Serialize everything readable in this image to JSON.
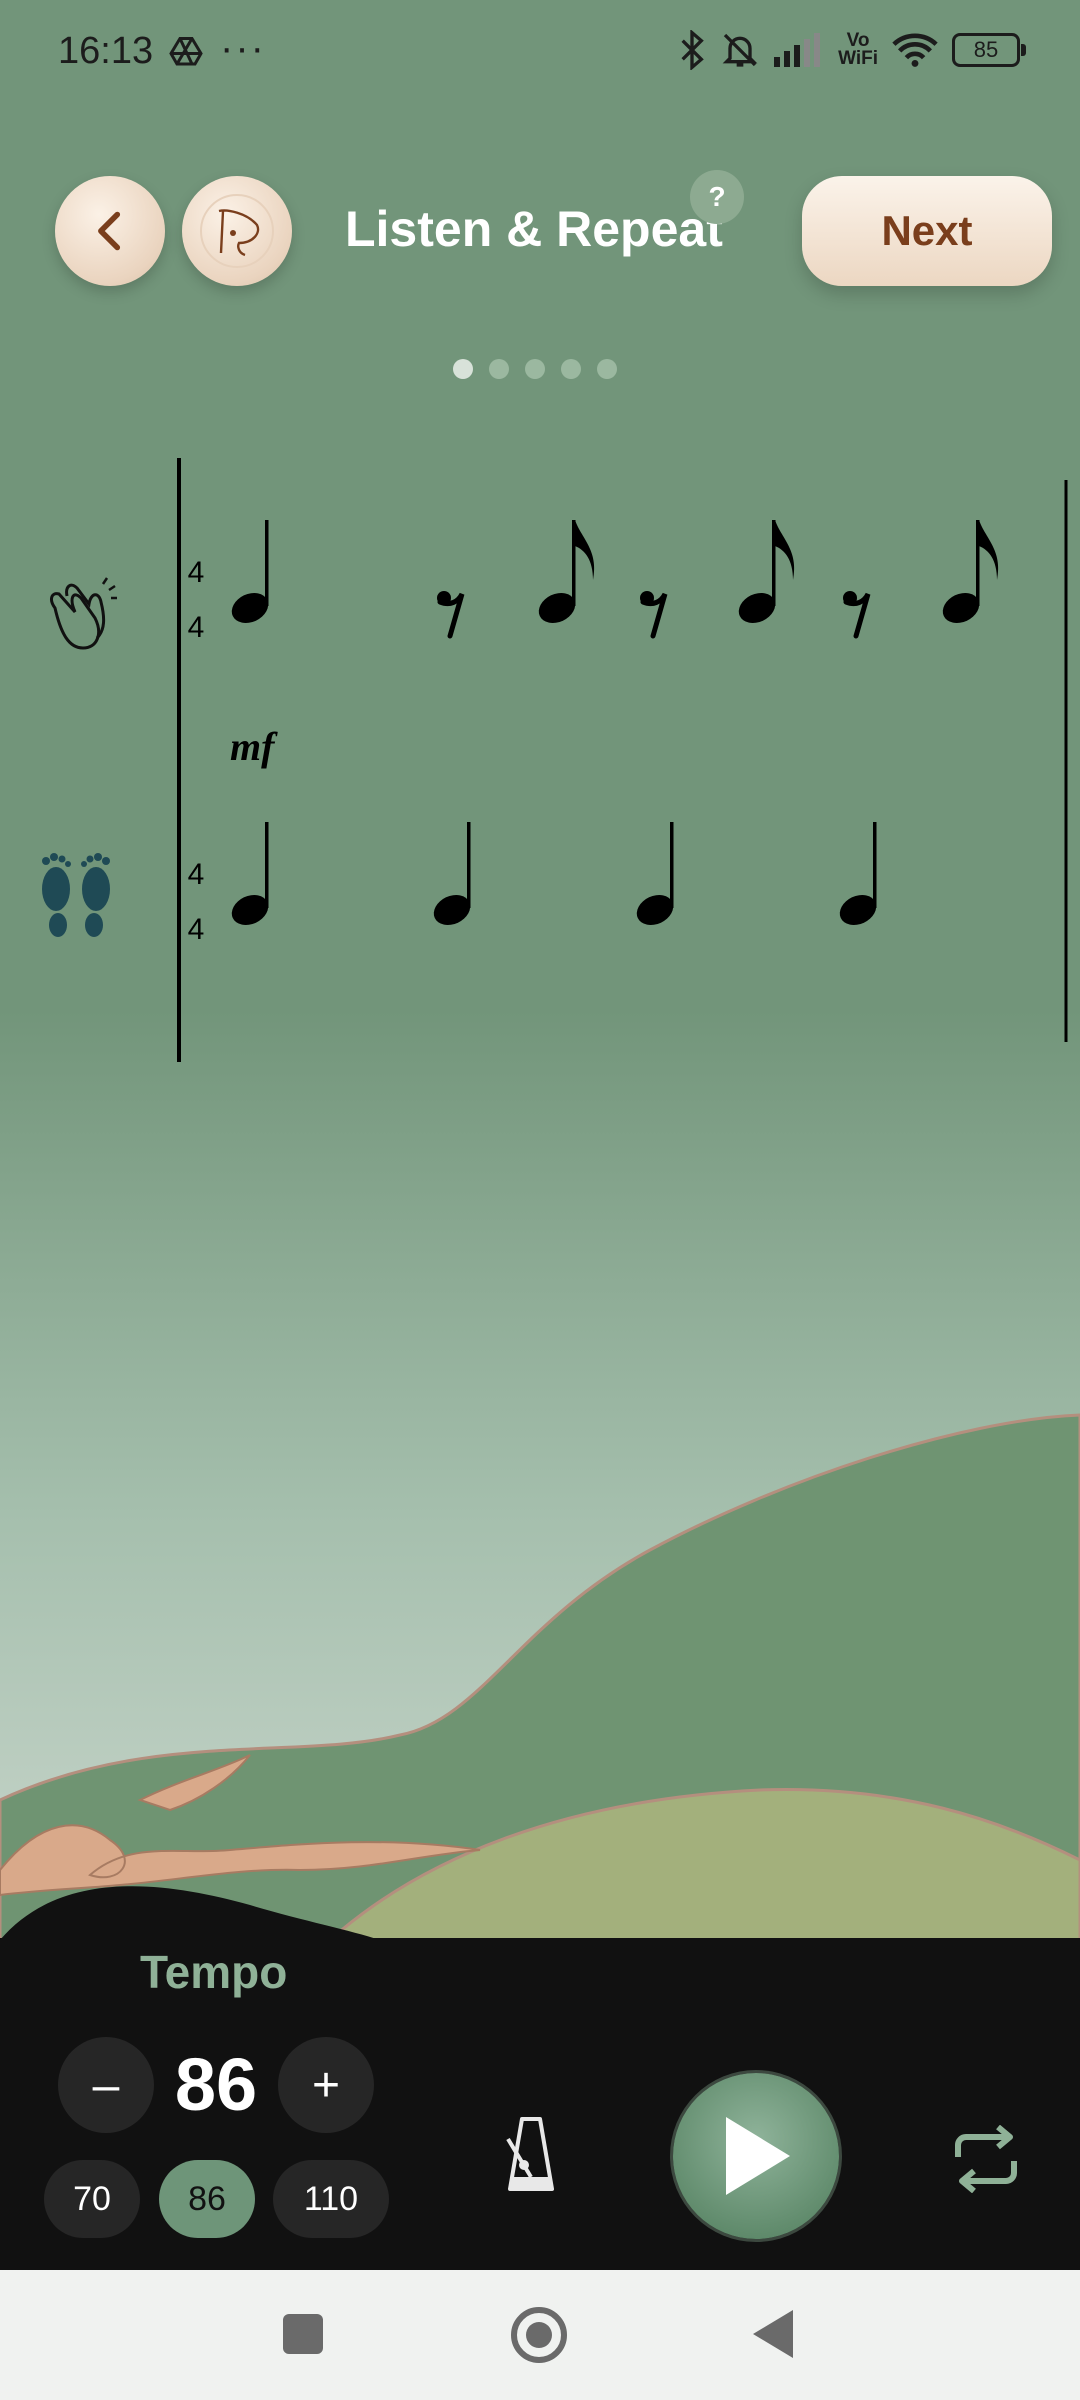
{
  "status_bar": {
    "time": "16:13",
    "dots": "···",
    "vowifi_top": "Vo",
    "vowifi_bottom": "WiFi",
    "battery": "85"
  },
  "header": {
    "title": "Listen & Repeat",
    "help": "?",
    "next_label": "Next"
  },
  "pager": {
    "count": 5,
    "active_index": 0
  },
  "score": {
    "time_signature_top": "4",
    "time_signature_bottom": "4",
    "dynamic": "mf",
    "clap_row_icon": "clapping-hands-icon",
    "feet_row_icon": "footprints-icon"
  },
  "tempo": {
    "label": "Tempo",
    "minus": "–",
    "plus": "+",
    "value": "86",
    "presets": [
      "70",
      "86",
      "110"
    ],
    "selected_preset": "86"
  },
  "colors": {
    "background": "#72957a",
    "panel": "#111111",
    "accent": "#6e9579",
    "next_text": "#7a3e1c",
    "foot_icon": "#1f4a55"
  }
}
